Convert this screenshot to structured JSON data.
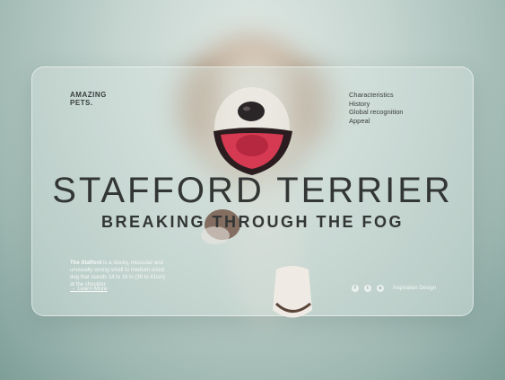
{
  "brand": {
    "line1": "AMAZING",
    "line2": "PETS."
  },
  "nav": {
    "items": [
      "Characteristics",
      "History",
      "Global recognition",
      "Appeal"
    ]
  },
  "hero": {
    "title": "STAFFORD TERRIER",
    "subtitle": "BREAKING THROUGH THE FOG"
  },
  "description": {
    "lead": "The Stafford",
    "body": " is a stocky, muscular and unusually strong small to medium-sized dog that stands 14 to 16 in (36 to 41cm) at the shoulder."
  },
  "learn_more": {
    "label": "Learn More",
    "icon": "arrow-right-icon"
  },
  "social": {
    "icons": [
      "facebook-icon",
      "twitter-icon",
      "instagram-icon"
    ],
    "glyphs": [
      "f",
      "t",
      "o"
    ]
  },
  "credit": "Inspiration Design",
  "colors": {
    "background": "#c7d6d1",
    "text_dark": "#323635",
    "text_light": "#f5f8f7",
    "tongue": "#d63a52",
    "nose": "#2a2526"
  }
}
